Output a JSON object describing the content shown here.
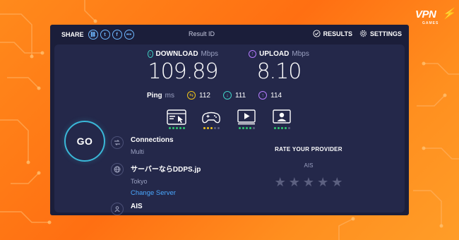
{
  "brand": {
    "logo_text": "VPN",
    "logo_sub": "GAMES"
  },
  "topbar": {
    "share_label": "SHARE",
    "share_icons": [
      "link-icon",
      "twitter-icon",
      "facebook-icon",
      "more-icon"
    ],
    "share_glyphs": [
      "⛓",
      "t",
      "f",
      "•••"
    ],
    "result_id_label": "Result ID",
    "results_label": "RESULTS",
    "settings_label": "SETTINGS"
  },
  "download": {
    "label": "DOWNLOAD",
    "unit": "Mbps",
    "value": "109.89",
    "color": "#3fd1c5"
  },
  "upload": {
    "label": "UPLOAD",
    "unit": "Mbps",
    "value": "8.10",
    "color": "#b57bff"
  },
  "ping": {
    "label": "Ping",
    "unit": "ms",
    "idle": "112",
    "download": "111",
    "upload": "114",
    "colors": {
      "idle": "#f0c419",
      "download": "#3fd1c5",
      "upload": "#b57bff"
    }
  },
  "performance": [
    {
      "icon": "browsing-icon",
      "rating_dots": [
        "#2ecc71",
        "#2ecc71",
        "#2ecc71",
        "#2ecc71",
        "#2ecc71"
      ]
    },
    {
      "icon": "gaming-icon",
      "rating_dots": [
        "#f0c419",
        "#f0c419",
        "#f0c419",
        "#5c6080",
        "#5c6080"
      ]
    },
    {
      "icon": "streaming-icon",
      "rating_dots": [
        "#2ecc71",
        "#2ecc71",
        "#2ecc71",
        "#2ecc71",
        "#5c6080"
      ]
    },
    {
      "icon": "video-chat-icon",
      "rating_dots": [
        "#2ecc71",
        "#2ecc71",
        "#2ecc71",
        "#2ecc71",
        "#5c6080"
      ]
    }
  ],
  "go_button": "GO",
  "connections": {
    "title": "Connections",
    "value": "Multi"
  },
  "server": {
    "title": "サーバーならDDPS.jp",
    "location": "Tokyo",
    "change_label": "Change Server"
  },
  "isp": {
    "title": "AIS"
  },
  "rating": {
    "title": "RATE YOUR PROVIDER",
    "isp": "AIS",
    "stars": 5
  }
}
